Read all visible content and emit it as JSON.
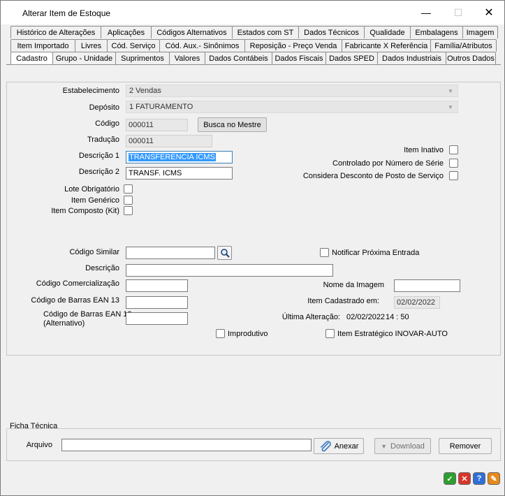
{
  "window": {
    "title": "Alterar Item de Estoque",
    "min_glyph": "—",
    "max_glyph": "☐",
    "close_glyph": "✕"
  },
  "tabs": {
    "row1": [
      "Histórico de Alterações",
      "Aplicações",
      "Códigos Alternativos",
      "Estados com ST",
      "Dados Técnicos",
      "Qualidade",
      "Embalagens",
      "Imagem"
    ],
    "row2": [
      "Item Importado",
      "Livres",
      "Cód. Serviço",
      "Cód. Aux.- Sinônimos",
      "Reposição - Preço Venda",
      "Fabricante X Referência",
      "Família/Atributos"
    ],
    "row3": [
      "Cadastro",
      "Grupo - Unidade",
      "Suprimentos",
      "Valores",
      "Dados Contábeis",
      "Dados Fiscais",
      "Dados SPED",
      "Dados Industriais",
      "Outros Dados"
    ],
    "active": "Cadastro"
  },
  "form": {
    "estabelecimento_label": "Estabelecimento",
    "estabelecimento_value": "2 Vendas",
    "deposito_label": "Depósito",
    "deposito_value": "1 FATURAMENTO",
    "codigo_label": "Código",
    "codigo_value": "000011",
    "busca_button": "Busca no Mestre",
    "traducao_label": "Tradução",
    "traducao_value": "000011",
    "descricao1_label": "Descrição 1",
    "descricao1_value": "TRANSFERENCIA ICMS",
    "descricao2_label": "Descrição 2",
    "descricao2_value": "TRANSF. ICMS",
    "item_inativo_label": "Item Inativo",
    "controlado_serie_label": "Controlado por Número de Série",
    "desconto_posto_label": "Considera Desconto de Posto de Serviço",
    "lote_obrigatorio_label": "Lote Obrigatório",
    "item_generico_label": "Item Genérico",
    "item_composto_label": "Item Composto (Kit)",
    "codigo_similar_label": "Código Similar",
    "codigo_similar_value": "",
    "notificar_label": "Notificar Próxima Entrada",
    "descricao_label": "Descrição",
    "descricao_value": "",
    "codigo_comercializacao_label": "Código Comercialização",
    "codigo_comercializacao_value": "",
    "nome_imagem_label": "Nome da Imagem",
    "nome_imagem_value": "",
    "ean13_label": "Código de Barras EAN 13",
    "ean13_value": "",
    "item_cadastrado_label": "Item Cadastrado em:",
    "item_cadastrado_value": "02/02/2022",
    "ean13_alt_label_line1": "Código de Barras EAN 13",
    "ean13_alt_label_line2": "(Alternativo)",
    "ean13_alt_value": "",
    "ultima_alteracao_label": "Última Alteração:",
    "ultima_alteracao_date": "02/02/2022",
    "ultima_alteracao_time": "14 : 50",
    "improdutivo_label": "Improdutivo",
    "estrategico_label": "Item Estratégico INOVAR-AUTO"
  },
  "ficha": {
    "title": "Ficha Técnica",
    "arquivo_label": "Arquivo",
    "arquivo_value": "",
    "anexar_button": "Anexar",
    "download_button": "Download",
    "remover_button": "Remover"
  },
  "footer_icons": [
    "confirm-icon",
    "cancel-icon",
    "help-icon",
    "tools-icon"
  ],
  "colors": {
    "selection": "#3399ff",
    "confirm": "#2e9e2e",
    "cancel": "#d9342b",
    "help": "#2f6fd6",
    "tools": "#e8891a"
  }
}
